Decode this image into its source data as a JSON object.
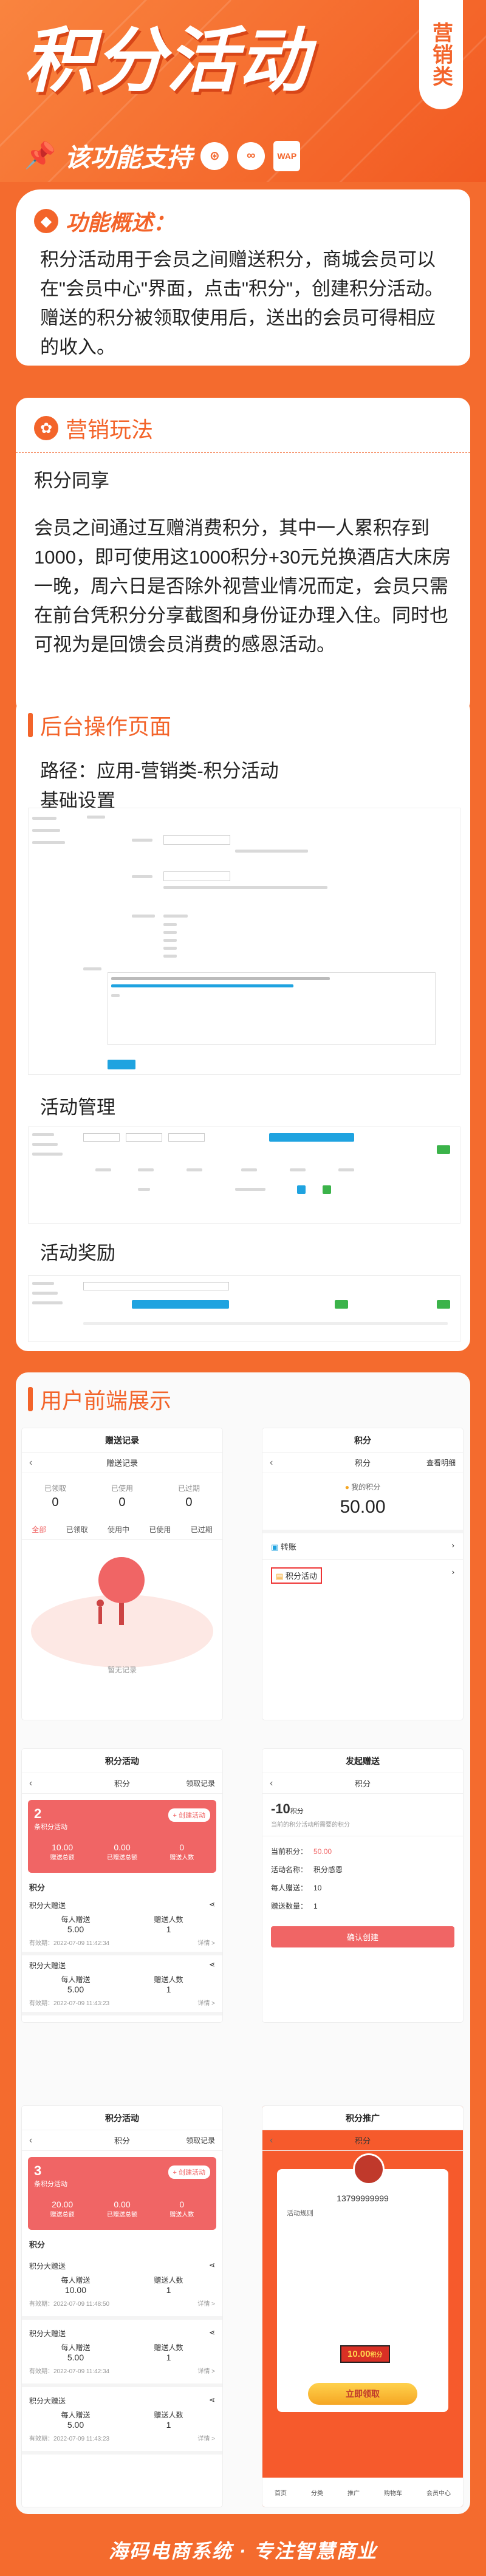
{
  "header": {
    "title": "积分活动",
    "tag": "营销类",
    "support_label": "该功能支持",
    "platforms": [
      "小程序",
      "H5",
      "WAP"
    ]
  },
  "overview": {
    "title": "功能概述：",
    "text": "积分活动用于会员之间赠送积分，商城会员可以在\"会员中心\"界面，点击\"积分\"，创建积分活动。赠送的积分被领取使用后，送出的会员可得相应的收入。"
  },
  "marketing": {
    "title": "营销玩法",
    "subtitle": "积分同享",
    "text": "会员之间通过互赠消费积分，其中一人累积存到1000，即可使用这1000积分+30元兑换酒店大床房一晚，周六日是否除外视营业情况而定，会员只需在前台凭积分分享截图和身份证办理入住。同时也可视为是回馈会员消费的感恩活动。"
  },
  "backend": {
    "title": "后台操作页面",
    "path": "路径：应用-营销类-积分活动",
    "basic": "基础设置",
    "manage": "活动管理",
    "reward": "活动奖励"
  },
  "frontend": {
    "title": "用户前端展示"
  },
  "phone1": {
    "title": "赠送记录",
    "sub": "赠送记录",
    "stats": [
      {
        "label": "已领取",
        "value": "0"
      },
      {
        "label": "已使用",
        "value": "0"
      },
      {
        "label": "已过期",
        "value": "0"
      }
    ],
    "tabs": [
      "全部",
      "已领取",
      "使用中",
      "已使用",
      "已过期"
    ],
    "empty": "暂无记录"
  },
  "phone2": {
    "title": "积分",
    "sub": "积分",
    "right": "查看明细",
    "my_points_label": "我的积分",
    "points": "50.00",
    "rows": [
      "转账",
      "积分活动"
    ]
  },
  "phone3": {
    "title": "积分活动",
    "sub": "积分",
    "right": "领取记录",
    "count": "2",
    "count_label": "条积分活动",
    "create": "+ 创建活动",
    "stats": [
      {
        "value": "10.00",
        "label": "赠送总额"
      },
      {
        "value": "0.00",
        "label": "已赠送总额"
      },
      {
        "value": "0",
        "label": "赠送人数"
      }
    ],
    "section": "积分",
    "items": [
      {
        "name": "积分大赠送",
        "per": "每人赠送",
        "per_value": "5.00",
        "people": "赠送人数",
        "people_value": "1",
        "time": "有效期：2022-07-09 11:42:34",
        "detail": "详情 >"
      },
      {
        "name": "积分大赠送",
        "per": "每人赠送",
        "per_value": "5.00",
        "people": "赠送人数",
        "people_value": "1",
        "time": "有效期：2022-07-09 11:43:23",
        "detail": "详情 >"
      }
    ]
  },
  "phone4": {
    "title": "发起赠送",
    "sub": "积分",
    "amount": "-10",
    "amount_unit": "积分",
    "hint": "当前的积分活动所需要的积分",
    "rows": [
      {
        "label": "当前积分：",
        "value": "50.00"
      },
      {
        "label": "活动名称：",
        "value": "积分感恩"
      },
      {
        "label": "每人赠送：",
        "value": "10"
      },
      {
        "label": "赠送数量：",
        "value": "1"
      }
    ],
    "button": "确认创建"
  },
  "phone5": {
    "title": "积分活动",
    "sub": "积分",
    "right": "领取记录",
    "count": "3",
    "count_label": "条积分活动",
    "create": "+ 创建活动",
    "stats": [
      {
        "value": "20.00",
        "label": "赠送总额"
      },
      {
        "value": "0.00",
        "label": "已赠送总额"
      },
      {
        "value": "0",
        "label": "赠送人数"
      }
    ],
    "section": "积分",
    "items": [
      {
        "name": "积分大赠送",
        "per": "每人赠送",
        "per_value": "10.00",
        "people": "赠送人数",
        "people_value": "1",
        "time": "有效期：2022-07-09 11:48:50",
        "detail": "详情 >"
      },
      {
        "name": "积分大赠送",
        "per": "每人赠送",
        "per_value": "5.00",
        "people": "赠送人数",
        "people_value": "1",
        "time": "有效期：2022-07-09 11:42:34",
        "detail": "详情 >"
      },
      {
        "name": "积分大赠送",
        "per": "每人赠送",
        "per_value": "5.00",
        "people": "赠送人数",
        "people_value": "1",
        "time": "有效期：2022-07-09 11:43:23",
        "detail": "详情 >"
      }
    ]
  },
  "phone6": {
    "title": "积分推广",
    "sub": "积分",
    "phone_no": "13799999999",
    "activity": "活动规则",
    "value": "10.00",
    "unit": "积分",
    "button": "立即领取",
    "nav": [
      "首页",
      "分类",
      "推广",
      "购物车",
      "会员中心"
    ]
  },
  "footer": {
    "text": "海码电商系统 · 专注智慧商业"
  },
  "colors": {
    "brand": "#f46b2e",
    "card_red": "#f06565",
    "blue": "#1fa3e0",
    "green": "#3bb34a"
  }
}
